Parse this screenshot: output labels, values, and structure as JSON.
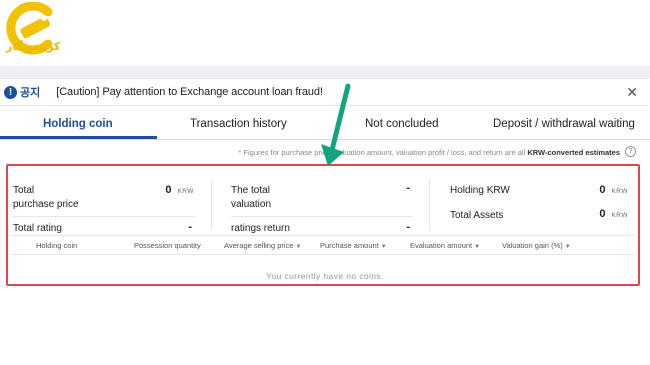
{
  "logo": {
    "icon": "cryptonegar-logo-icon",
    "text": "کریپتونگار",
    "color": "#f2c200"
  },
  "notice": {
    "icon": "exclamation-circle-icon",
    "icon_glyph": "!",
    "tag": "공지",
    "text": "[Caution] Pay attention to Exchange account loan fraud!",
    "close_icon": "close-icon",
    "close_glyph": "✕"
  },
  "tabs": [
    {
      "label": "Holding coin",
      "active": true
    },
    {
      "label": "Transaction history",
      "active": false
    },
    {
      "label": "Not concluded",
      "active": false
    },
    {
      "label": "Deposit / withdrawal waiting",
      "active": false
    }
  ],
  "footnote": {
    "text": "* Figures for purchase price, valuation amount, valuation profit / loss, and return are all",
    "bold": "KRW-converted estimates",
    "help_glyph": "?"
  },
  "summary": {
    "total_purchase_label_1": "Total",
    "total_purchase_label_2": "purchase price",
    "total_purchase_value": "0",
    "total_purchase_unit": "KRW",
    "total_rating_label": "Total rating",
    "total_rating_value": "-",
    "total_valuation_label_1": "The total",
    "total_valuation_label_2": "valuation",
    "total_valuation_value": "-",
    "ratings_return_label": "ratings return",
    "ratings_return_value": "-",
    "holding_krw_label": "Holding KRW",
    "holding_krw_value": "0",
    "holding_krw_unit": "KRW",
    "total_assets_label": "Total Assets",
    "total_assets_value": "0",
    "total_assets_unit": "KRW"
  },
  "table": {
    "headers": [
      {
        "label": "Holding coin",
        "sortable": false
      },
      {
        "label": "Possession quantity",
        "sortable": false
      },
      {
        "label": "Average selling price",
        "sortable": true
      },
      {
        "label": "Purchase amount",
        "sortable": true
      },
      {
        "label": "Evaluation amount",
        "sortable": true
      },
      {
        "label": "Valuation gain (%)",
        "sortable": true
      }
    ],
    "caret_glyph": "▼",
    "empty_text": "You currently have no coins."
  },
  "colors": {
    "accent": "#1b4fa0",
    "highlight_box": "#e0454f",
    "arrow": "#14a37f"
  }
}
